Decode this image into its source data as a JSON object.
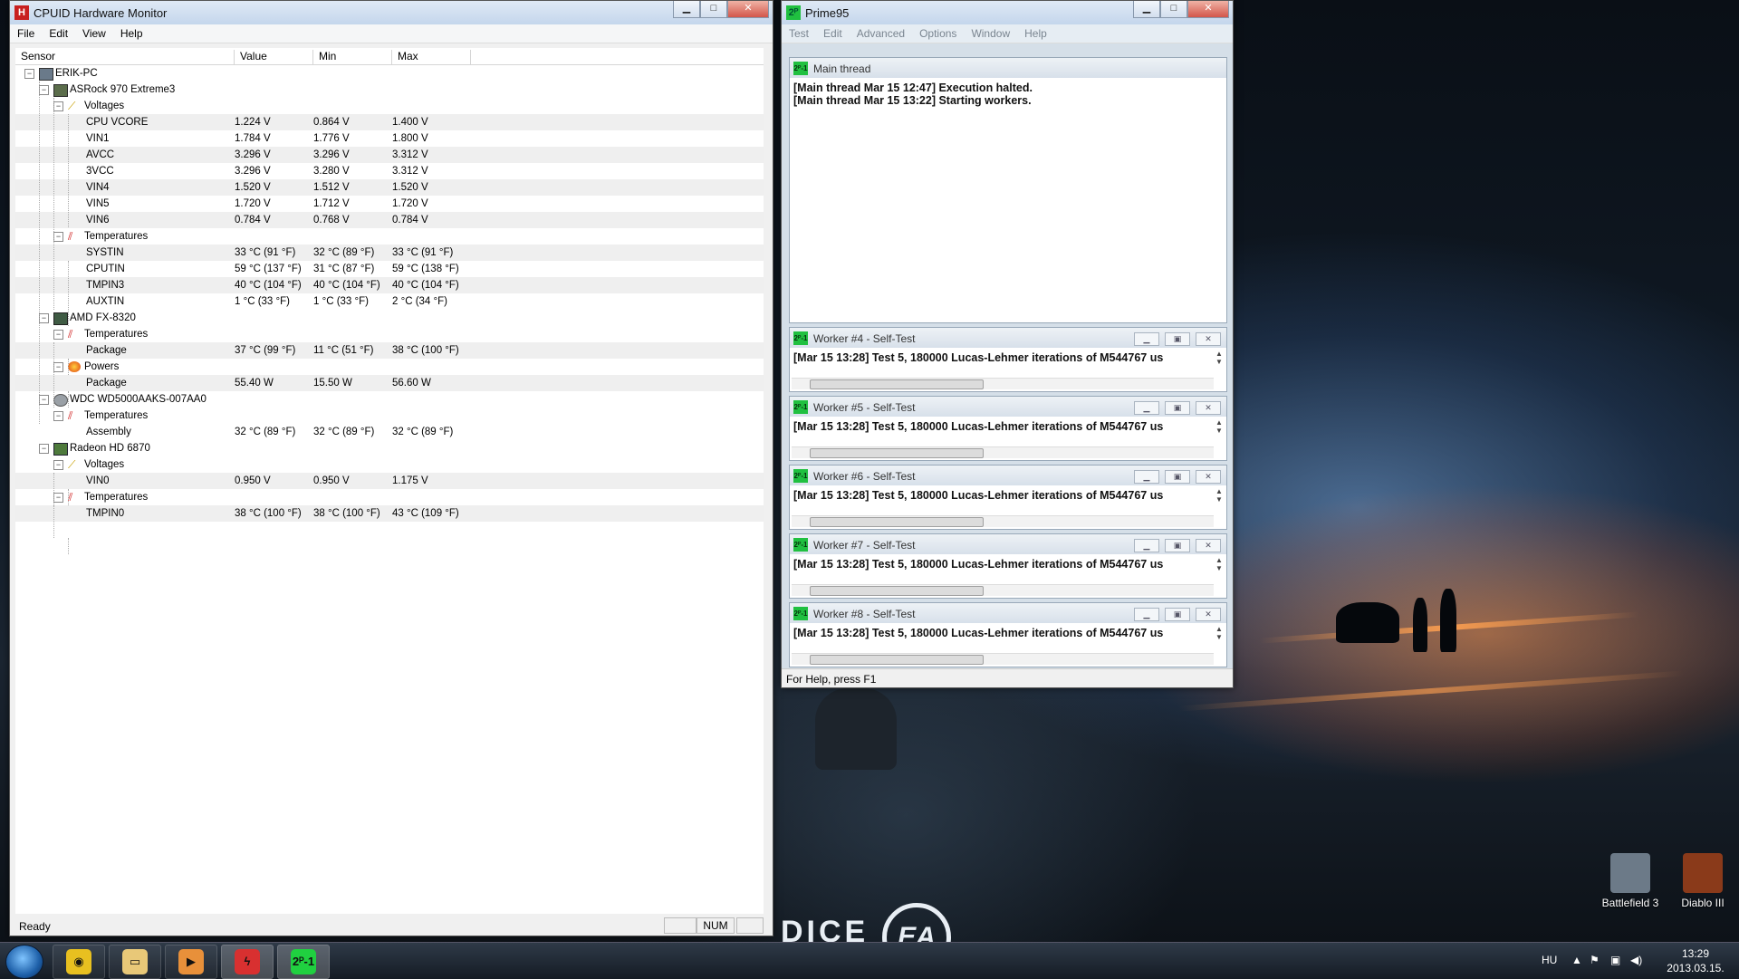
{
  "hwmonitor": {
    "title": "CPUID Hardware Monitor",
    "app_icon": "H",
    "menu": [
      "File",
      "Edit",
      "View",
      "Help"
    ],
    "columns": [
      "Sensor",
      "Value",
      "Min",
      "Max"
    ],
    "status": "Ready",
    "status_num": "NUM",
    "rows": [
      {
        "label": "ERIK-PC",
        "level": 0,
        "icon": "computer-icon",
        "exp": "−"
      },
      {
        "label": "ASRock 970 Extreme3",
        "level": 1,
        "icon": "motherboard-icon",
        "exp": "−"
      },
      {
        "label": "Voltages",
        "level": 2,
        "icon": "voltage-icon",
        "exp": "−"
      },
      {
        "label": "CPU VCORE",
        "level": 3,
        "value": "1.224 V",
        "min": "0.864 V",
        "max": "1.400 V"
      },
      {
        "label": "VIN1",
        "level": 3,
        "value": "1.784 V",
        "min": "1.776 V",
        "max": "1.800 V"
      },
      {
        "label": "AVCC",
        "level": 3,
        "value": "3.296 V",
        "min": "3.296 V",
        "max": "3.312 V"
      },
      {
        "label": "3VCC",
        "level": 3,
        "value": "3.296 V",
        "min": "3.280 V",
        "max": "3.312 V"
      },
      {
        "label": "VIN4",
        "level": 3,
        "value": "1.520 V",
        "min": "1.512 V",
        "max": "1.520 V"
      },
      {
        "label": "VIN5",
        "level": 3,
        "value": "1.720 V",
        "min": "1.712 V",
        "max": "1.720 V"
      },
      {
        "label": "VIN6",
        "level": 3,
        "value": "0.784 V",
        "min": "0.768 V",
        "max": "0.784 V"
      },
      {
        "label": "Temperatures",
        "level": 2,
        "icon": "thermometer-icon",
        "exp": "−"
      },
      {
        "label": "SYSTIN",
        "level": 3,
        "value": "33 °C  (91 °F)",
        "min": "32 °C  (89 °F)",
        "max": "33 °C  (91 °F)"
      },
      {
        "label": "CPUTIN",
        "level": 3,
        "value": "59 °C  (137 °F)",
        "min": "31 °C  (87 °F)",
        "max": "59 °C  (138 °F)"
      },
      {
        "label": "TMPIN3",
        "level": 3,
        "value": "40 °C  (104 °F)",
        "min": "40 °C  (104 °F)",
        "max": "40 °C  (104 °F)"
      },
      {
        "label": "AUXTIN",
        "level": 3,
        "value": "1 °C  (33 °F)",
        "min": "1 °C  (33 °F)",
        "max": "2 °C  (34 °F)"
      },
      {
        "label": "AMD FX-8320",
        "level": 1,
        "icon": "cpu-icon",
        "exp": "−"
      },
      {
        "label": "Temperatures",
        "level": 2,
        "icon": "thermometer-icon",
        "exp": "−"
      },
      {
        "label": "Package",
        "level": 3,
        "value": "37 °C  (99 °F)",
        "min": "11 °C  (51 °F)",
        "max": "38 °C  (100 °F)"
      },
      {
        "label": "Powers",
        "level": 2,
        "icon": "power-icon",
        "exp": "−"
      },
      {
        "label": "Package",
        "level": 3,
        "value": "55.40 W",
        "min": "15.50 W",
        "max": "56.60 W"
      },
      {
        "label": "WDC WD5000AAKS-007AA0",
        "level": 1,
        "icon": "hard-drive-icon",
        "exp": "−"
      },
      {
        "label": "Temperatures",
        "level": 2,
        "icon": "thermometer-icon",
        "exp": "−"
      },
      {
        "label": "Assembly",
        "level": 3,
        "value": "32 °C  (89 °F)",
        "min": "32 °C  (89 °F)",
        "max": "32 °C  (89 °F)"
      },
      {
        "label": "Radeon HD 6870",
        "level": 1,
        "icon": "gpu-icon",
        "exp": "−"
      },
      {
        "label": "Voltages",
        "level": 2,
        "icon": "voltage-icon",
        "exp": "−"
      },
      {
        "label": "VIN0",
        "level": 3,
        "value": "0.950 V",
        "min": "0.950 V",
        "max": "1.175 V"
      },
      {
        "label": "Temperatures",
        "level": 2,
        "icon": "thermometer-icon",
        "exp": "−"
      },
      {
        "label": "TMPIN0",
        "level": 3,
        "value": "38 °C  (100 °F)",
        "min": "38 °C  (100 °F)",
        "max": "43 °C  (109 °F)"
      }
    ]
  },
  "prime95": {
    "title": "Prime95",
    "menu": [
      "Test",
      "Edit",
      "Advanced",
      "Options",
      "Window",
      "Help"
    ],
    "main_thread": {
      "title": "Main thread",
      "lines": [
        "[Main thread Mar 15 12:47] Execution halted.",
        "[Main thread Mar 15 13:22] Starting workers."
      ]
    },
    "workers": [
      {
        "title": "Worker #4 - Self-Test",
        "line": "[Mar 15 13:28] Test 5, 180000 Lucas-Lehmer iterations of M544767 us"
      },
      {
        "title": "Worker #5 - Self-Test",
        "line": "[Mar 15 13:28] Test 5, 180000 Lucas-Lehmer iterations of M544767 us"
      },
      {
        "title": "Worker #6 - Self-Test",
        "line": "[Mar 15 13:28] Test 5, 180000 Lucas-Lehmer iterations of M544767 us"
      },
      {
        "title": "Worker #7 - Self-Test",
        "line": "[Mar 15 13:28] Test 5, 180000 Lucas-Lehmer iterations of M544767 us"
      },
      {
        "title": "Worker #8 - Self-Test",
        "line": "[Mar 15 13:28] Test 5, 180000 Lucas-Lehmer iterations of M544767 us"
      }
    ],
    "status": "For Help, press F1"
  },
  "desktop": {
    "logo_dice": "DICE",
    "logo_ea": "EA",
    "icons": [
      {
        "label": "Battlefield 3",
        "icon": "battlefield-3-icon",
        "color": "#6c7a88"
      },
      {
        "label": "Diablo III",
        "icon": "diablo-3-icon",
        "color": "#8a3a1a"
      }
    ]
  },
  "taskbar": {
    "apps": [
      {
        "name": "chrome-taskbar-button",
        "glyph": "◉",
        "color": "#e8c020"
      },
      {
        "name": "explorer-taskbar-button",
        "glyph": "▭",
        "color": "#e8c878"
      },
      {
        "name": "media-player-taskbar-button",
        "glyph": "▶",
        "color": "#e8903a"
      },
      {
        "name": "hwmonitor-taskbar-button",
        "glyph": "ϟ",
        "color": "#d83030"
      },
      {
        "name": "prime95-taskbar-button",
        "glyph": "2ᴾ-1",
        "color": "#20d040"
      }
    ],
    "lang": "HU",
    "time": "13:29",
    "date": "2013.03.15."
  }
}
